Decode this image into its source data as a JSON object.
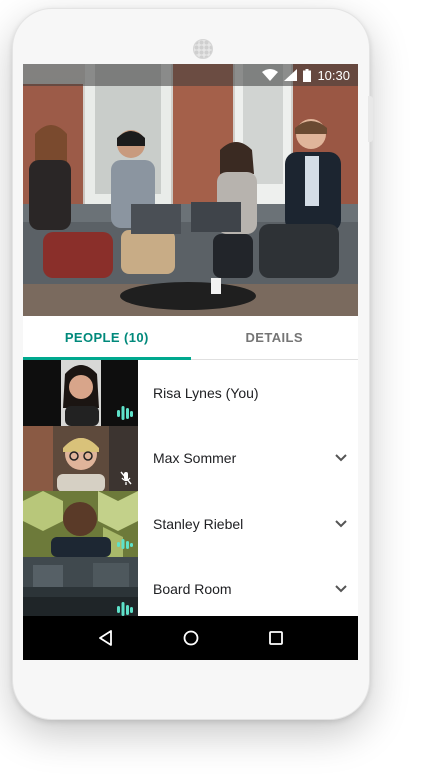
{
  "status_bar": {
    "time": "10:30"
  },
  "tabs": [
    {
      "label": "PEOPLE (10)",
      "active": true
    },
    {
      "label": "DETAILS",
      "active": false
    }
  ],
  "people": [
    {
      "name": "Risa Lynes (You)",
      "audio": "speaking",
      "has_menu": false
    },
    {
      "name": "Max Sommer",
      "audio": "muted",
      "has_menu": true
    },
    {
      "name": "Stanley Riebel",
      "audio": "speaking",
      "has_menu": true
    },
    {
      "name": "Board Room",
      "audio": "speaking",
      "has_menu": true
    }
  ],
  "colors": {
    "accent": "#00a88e",
    "tab_active_text": "#00897b",
    "sound_bars": "#5ee1c9"
  },
  "icons": [
    "wifi-icon",
    "signal-icon",
    "battery-icon",
    "sound-bars-icon",
    "mic-muted-icon",
    "chevron-down-icon",
    "back-icon",
    "home-icon",
    "recents-icon"
  ]
}
